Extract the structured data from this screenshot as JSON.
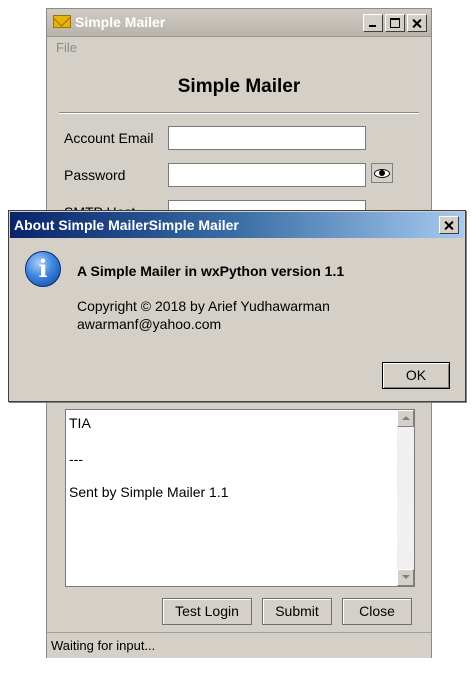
{
  "main_window": {
    "title": "Simple Mailer",
    "menu": {
      "file": "File"
    },
    "header": "Simple Mailer",
    "form": {
      "account_email_label": "Account Email",
      "password_label": "Password",
      "smtp_host_label": "SMTP Host"
    },
    "message_lines": [
      "TIA",
      "---",
      "Sent by Simple Mailer 1.1"
    ],
    "buttons": {
      "test_login": "Test Login",
      "submit": "Submit",
      "close": "Close"
    },
    "status": "Waiting for input..."
  },
  "about_dialog": {
    "title": "About Simple MailerSimple Mailer",
    "heading": "A Simple Mailer in wxPython version 1.1",
    "copyright": "Copyright © 2018 by Arief Yudhawarman",
    "email": "awarmanf@yahoo.com",
    "ok_label": "OK",
    "icon": "info-icon"
  },
  "colors": {
    "window_bg": "#d4d0c8",
    "dialog_title_start": "#0a246a",
    "dialog_title_end": "#a6caf0"
  }
}
